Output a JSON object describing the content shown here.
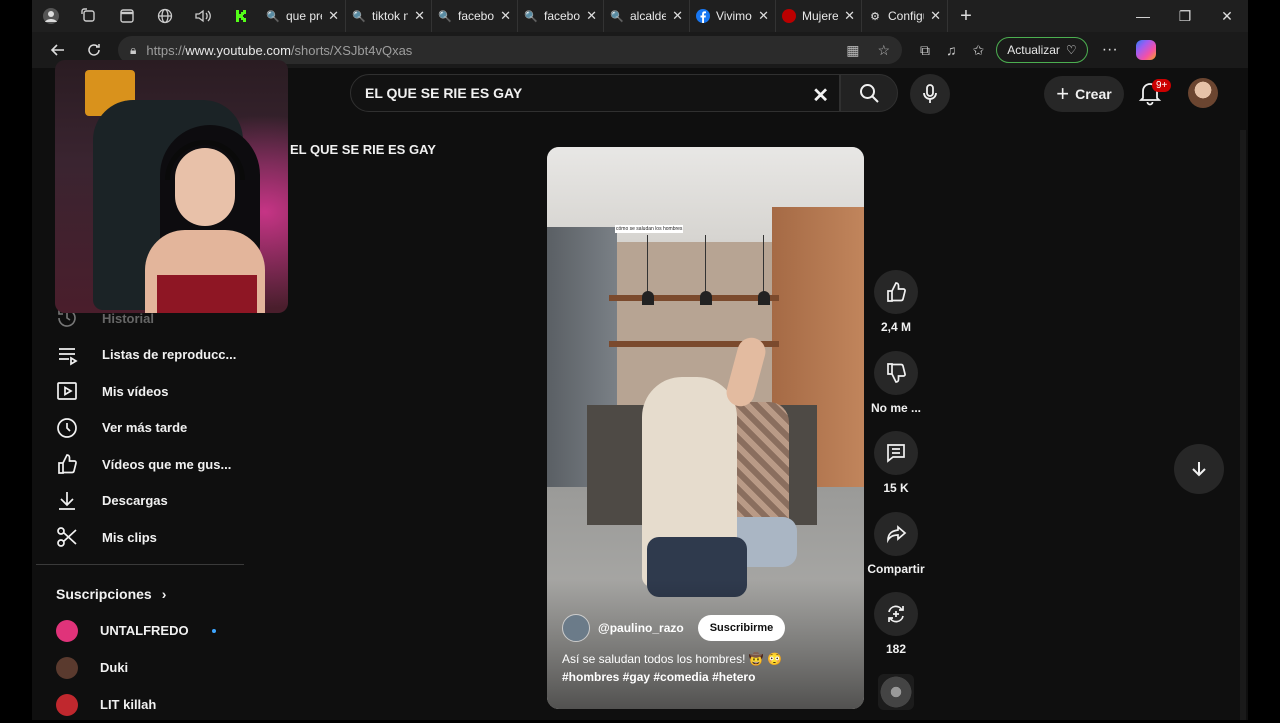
{
  "browser": {
    "tabs": [
      {
        "title": "que pref",
        "favicon": "search-icon"
      },
      {
        "title": "tiktok n",
        "favicon": "search-icon"
      },
      {
        "title": "faceboo",
        "favicon": "search-icon"
      },
      {
        "title": "faceboo",
        "favicon": "search-icon"
      },
      {
        "title": "alcalde",
        "favicon": "search-icon"
      },
      {
        "title": "Vivimos",
        "favicon": "facebook-icon"
      },
      {
        "title": "Mujeres",
        "favicon": "youtube-icon"
      },
      {
        "title": "Configu",
        "favicon": "gear-icon"
      }
    ],
    "url_prefix": "https://",
    "url_host": "www.youtube.com",
    "url_path": "/shorts/XSJbt4vQxas",
    "update_label": "Actualizar"
  },
  "youtube": {
    "search_value": "EL QUE SE RIE ES GAY",
    "query_label": "EL QUE SE RIE ES GAY",
    "create_label": "Crear",
    "notifications_badge": "9+",
    "sidebar": [
      {
        "label": "Historial",
        "icon": "history-icon"
      },
      {
        "label": "Listas de reproducc...",
        "icon": "playlist-icon"
      },
      {
        "label": "Mis vídeos",
        "icon": "my-videos-icon"
      },
      {
        "label": "Ver más tarde",
        "icon": "watch-later-icon"
      },
      {
        "label": "Vídeos que me gus...",
        "icon": "liked-icon"
      },
      {
        "label": "Descargas",
        "icon": "download-icon"
      },
      {
        "label": "Mis clips",
        "icon": "clips-icon"
      }
    ],
    "subscriptions_title": "Suscripciones",
    "subscriptions": [
      {
        "name": "UNTALFREDO",
        "color": "#e0337a"
      },
      {
        "name": "Duki",
        "color": "#5a3a2e"
      },
      {
        "name": "LIT killah",
        "color": "#c0282e"
      }
    ],
    "short": {
      "channel": "@paulino_razo",
      "subscribe_label": "Suscribirme",
      "caption": "Así se saludan todos los hombres! 🤠 😳",
      "hashtags": "#hombres #gay #comedia #hetero",
      "overlay_text": "cómo se saludan los hombres"
    },
    "actions": {
      "likes": "2,4 M",
      "dislike": "No me ...",
      "comments": "15 K",
      "share": "Compartir",
      "remix": "182"
    }
  },
  "colors": {
    "accent_blue": "#3ea6ff",
    "bg": "#0f0f0f",
    "badge_red": "#cc0000"
  }
}
